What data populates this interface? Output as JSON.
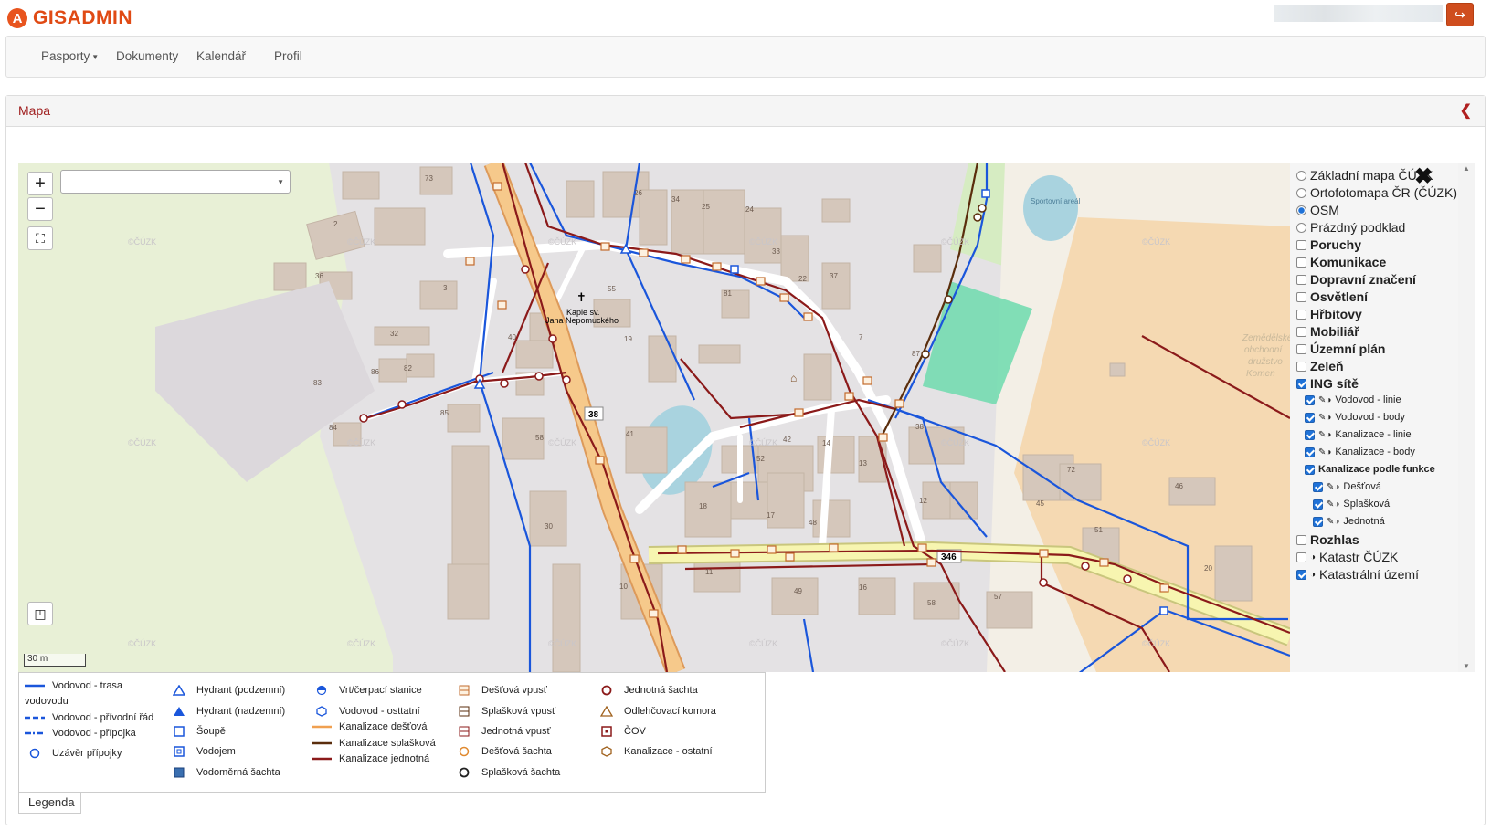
{
  "app": {
    "name": "GISADMIN",
    "logo_letter": "A"
  },
  "nav": {
    "items": [
      {
        "label": "Pasporty",
        "dropdown": true
      },
      {
        "label": "Dokumenty"
      },
      {
        "label": "Kalendář"
      },
      {
        "label": "Profil"
      }
    ]
  },
  "panel": {
    "title": "Mapa"
  },
  "map": {
    "zoom_in": "+",
    "zoom_out": "−",
    "search_value": "",
    "scale_label": "30 m",
    "watermark": "©ČÚZK",
    "place_label_1": "Kaple sv.",
    "place_label_2": "Jana Nepomuckého",
    "road_38": "38",
    "road_346": "346",
    "poi_sport": "Sportovní areál",
    "farm_1": "Zemědělské",
    "farm_2": "obchodní",
    "farm_3": "družstvo",
    "farm_4": "Komen",
    "house_numbers": [
      {
        "n": "73"
      },
      {
        "n": "2"
      },
      {
        "n": "36"
      },
      {
        "n": "3"
      },
      {
        "n": "32"
      },
      {
        "n": "86"
      },
      {
        "n": "82"
      },
      {
        "n": "83"
      },
      {
        "n": "84"
      },
      {
        "n": "85"
      },
      {
        "n": "40"
      },
      {
        "n": "55"
      },
      {
        "n": "19"
      },
      {
        "n": "26"
      },
      {
        "n": "34"
      },
      {
        "n": "25"
      },
      {
        "n": "24"
      },
      {
        "n": "33"
      },
      {
        "n": "22"
      },
      {
        "n": "37"
      },
      {
        "n": "81"
      },
      {
        "n": "7"
      },
      {
        "n": "87"
      },
      {
        "n": "41"
      },
      {
        "n": "58"
      },
      {
        "n": "52"
      },
      {
        "n": "42"
      },
      {
        "n": "14"
      },
      {
        "n": "13"
      },
      {
        "n": "38"
      },
      {
        "n": "72"
      },
      {
        "n": "46"
      },
      {
        "n": "45"
      },
      {
        "n": "12"
      },
      {
        "n": "18"
      },
      {
        "n": "17"
      },
      {
        "n": "48"
      },
      {
        "n": "30"
      },
      {
        "n": "10"
      },
      {
        "n": "11"
      },
      {
        "n": "49"
      },
      {
        "n": "16"
      },
      {
        "n": "58"
      },
      {
        "n": "57"
      },
      {
        "n": "51"
      },
      {
        "n": "20"
      }
    ]
  },
  "layers": {
    "base": [
      {
        "label": "Základní mapa ČÚZK",
        "checked": false
      },
      {
        "label": "Ortofotomapa ČR (ČÚZK)",
        "checked": false
      },
      {
        "label": "OSM",
        "checked": true
      },
      {
        "label": "Prázdný podklad",
        "checked": false
      }
    ],
    "groups": [
      {
        "label": "Poruchy",
        "checked": false
      },
      {
        "label": "Komunikace",
        "checked": false
      },
      {
        "label": "Dopravní značení",
        "checked": false
      },
      {
        "label": "Osvětlení",
        "checked": false
      },
      {
        "label": "Hřbitovy",
        "checked": false
      },
      {
        "label": "Mobiliář",
        "checked": false
      },
      {
        "label": "Územní plán",
        "checked": false
      },
      {
        "label": "Zeleň",
        "checked": false
      },
      {
        "label": "ING sítě",
        "checked": true
      }
    ],
    "ing": [
      {
        "label": "Vodovod - linie",
        "checked": true
      },
      {
        "label": "Vodovod - body",
        "checked": true
      },
      {
        "label": "Kanalizace - linie",
        "checked": true
      },
      {
        "label": "Kanalizace - body",
        "checked": true
      }
    ],
    "kan_func": {
      "label": "Kanalizace podle funkce",
      "checked": true
    },
    "kan_sub": [
      {
        "label": "Dešťová",
        "checked": true
      },
      {
        "label": "Splašková",
        "checked": true
      },
      {
        "label": "Jednotná",
        "checked": true
      }
    ],
    "tail": [
      {
        "label": "Rozhlas",
        "checked": false,
        "bold": true
      },
      {
        "label": "Katastr ČÚZK",
        "checked": false,
        "bold": false
      },
      {
        "label": "Katastrální území",
        "checked": true,
        "bold": false
      }
    ]
  },
  "legend": {
    "tab": "Legenda",
    "items": [
      {
        "label": "Vodovod - trasa",
        "label2": "vodovodu",
        "symbol": "line-blue"
      },
      {
        "label": "Vodovod - přívodní řád",
        "symbol": "dash-blue"
      },
      {
        "label": "Vodovod - přípojka",
        "symbol": "dashdot-blue"
      },
      {
        "label": "Uzávěr přípojky",
        "symbol": "circle-blue"
      },
      {
        "label": "Hydrant (podzemní)",
        "symbol": "triangle-blue-open"
      },
      {
        "label": "Hydrant (nadzemní)",
        "symbol": "triangle-blue-filled"
      },
      {
        "label": "Šoupě",
        "symbol": "square-blue-open"
      },
      {
        "label": "Vodojem",
        "symbol": "square-blue-double"
      },
      {
        "label": "Vodoměrná šachta",
        "symbol": "square-blue-filled"
      },
      {
        "label": "Vrt/čerpací stanice",
        "symbol": "halfcircle-blue"
      },
      {
        "label": "Vodovod - osttatní",
        "symbol": "hexagon-blue"
      },
      {
        "label": "Kanalizace dešťová",
        "symbol": "line-orange"
      },
      {
        "label": "Kanalizace splašková",
        "symbol": "line-brown"
      },
      {
        "label": "Kanalizace jednotná",
        "symbol": "line-darkred"
      },
      {
        "label": "Dešťová vpusť",
        "symbol": "grate-orange"
      },
      {
        "label": "Splašková vpusť",
        "symbol": "grate-brown"
      },
      {
        "label": "Jednotná vpusť",
        "symbol": "grate-darkred"
      },
      {
        "label": "Dešťová šachta",
        "symbol": "circle-orange"
      },
      {
        "label": "Splašková šachta",
        "symbol": "circle-black"
      },
      {
        "label": "Jednotná šachta",
        "symbol": "circle-darkred"
      },
      {
        "label": "Odlehčovací komora",
        "symbol": "triangle-orange"
      },
      {
        "label": "ČOV",
        "symbol": "square-darkred-dot"
      },
      {
        "label": "Kanalizace - ostatní",
        "symbol": "hexagon-orange"
      }
    ]
  },
  "colors": {
    "accent": "#e04a14",
    "title_red": "#a02020",
    "water": "#1a56db",
    "sewer_rain": "#f0a050",
    "sewer_waste": "#5a2d0c",
    "sewer_combined": "#8b1a1a"
  }
}
